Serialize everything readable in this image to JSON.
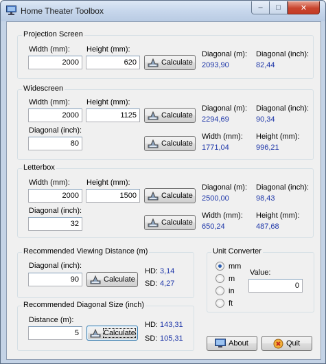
{
  "window": {
    "title": "Home Theater Toolbox",
    "min": "–",
    "max": "□",
    "close": "✕"
  },
  "calc_label": "Calculate",
  "projection": {
    "title": "Projection Screen",
    "width_label": "Width (mm):",
    "height_label": "Height (mm):",
    "width": "2000",
    "height": "620",
    "diag_m_label": "Diagonal (m):",
    "diag_m": "2093,90",
    "diag_inch_label": "Diagonal (inch):",
    "diag_inch": "82,44"
  },
  "widescreen": {
    "title": "Widescreen",
    "width_label": "Width (mm):",
    "height_label": "Height (mm):",
    "width": "2000",
    "height": "1125",
    "diag_m_label": "Diagonal (m):",
    "diag_m": "2294,69",
    "diag_inch_label": "Diagonal (inch):",
    "diag_inch": "90,34",
    "diag_input_label": "Diagonal (inch):",
    "diag_input": "80",
    "w_label": "Width (mm):",
    "w": "1771,04",
    "h_label": "Height (mm):",
    "h": "996,21"
  },
  "letterbox": {
    "title": "Letterbox",
    "width_label": "Width (mm):",
    "height_label": "Height (mm):",
    "width": "2000",
    "height": "1500",
    "diag_m_label": "Diagonal (m):",
    "diag_m": "2500,00",
    "diag_inch_label": "Diagonal (inch):",
    "diag_inch": "98,43",
    "diag_input_label": "Diagonal (inch):",
    "diag_input": "32",
    "w_label": "Width (mm):",
    "w": "650,24",
    "h_label": "Height (mm):",
    "h": "487,68"
  },
  "viewing": {
    "title": "Recommended Viewing Distance (m)",
    "diag_label": "Diagonal (inch):",
    "diag": "90",
    "hd_label": "HD:",
    "hd": "3,14",
    "sd_label": "SD:",
    "sd": "4,27"
  },
  "diagsize": {
    "title": "Recommended Diagonal Size (inch)",
    "dist_label": "Distance (m):",
    "dist": "5",
    "hd_label": "HD:",
    "hd": "143,31",
    "sd_label": "SD:",
    "sd": "105,31"
  },
  "converter": {
    "title": "Unit Converter",
    "units": [
      "mm",
      "m",
      "in",
      "ft"
    ],
    "selected": "mm",
    "value_label": "Value:",
    "value": "0"
  },
  "footer": {
    "about": "About",
    "quit": "Quit"
  },
  "colors": {
    "value_text": "#1c35a8",
    "title_bar": "#c7d7ec"
  }
}
